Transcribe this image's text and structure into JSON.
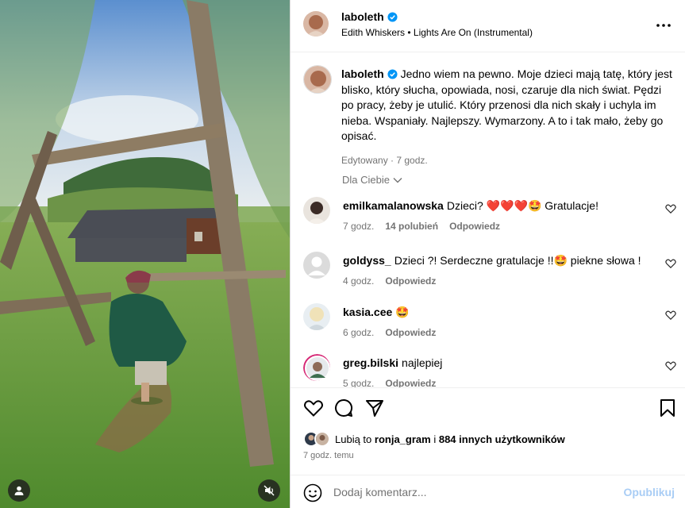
{
  "post": {
    "author": "laboleth",
    "song": "Edith Whiskers • Lights Are On (Instrumental)",
    "caption": "Jedno wiem na pewno. Moje dzieci mają tatę, który jest blisko, który słucha, opowiada, nosi, czaruje dla nich świat. Pędzi po pracy, żeby je utulić. Który przenosi dla nich skały i uchyla im nieba. Wspaniały. Najlepszy. Wymarzony. A to i tak mało, żeby go opisać.",
    "caption_meta": "Edytowany · 7 godz.",
    "filter_label": "Dla Ciebie"
  },
  "comments": [
    {
      "user": "emilkamalanowska",
      "text": "Dzieci? ❤️❤️❤️🤩 Gratulacje!",
      "time": "7 godz.",
      "likes": "14 polubień",
      "reply": "Odpowiedz"
    },
    {
      "user": "goldyss_",
      "text": "Dzieci ?! Serdeczne gratulacje !!🤩 piekne słowa !",
      "time": "4 godz.",
      "likes": "",
      "reply": "Odpowiedz"
    },
    {
      "user": "kasia.cee",
      "text": "🤩",
      "time": "6 godz.",
      "likes": "",
      "reply": "Odpowiedz"
    },
    {
      "user": "greg.bilski",
      "text": "najlepiej",
      "time": "5 godz.",
      "likes": "",
      "reply": "Odpowiedz"
    }
  ],
  "likes": {
    "prefix": "Lubią to",
    "user": "ronja_gram",
    "joiner": "i",
    "others": "884 innych użytkowników"
  },
  "timestamp": "7 godz. temu",
  "add_comment": {
    "placeholder": "Dodaj komentarz...",
    "publish_label": "Opublikuj"
  },
  "icons": {
    "more": "more-horizontal-icon",
    "like": "heart-icon",
    "comment": "comment-icon",
    "share": "share-icon",
    "save": "bookmark-icon",
    "emoji": "emoji-icon",
    "tag": "user-tag-icon",
    "mute": "muted-speaker-icon",
    "verified": "verified-badge-icon",
    "filter_chevron": "chevron-down-icon"
  },
  "colors": {
    "verified": "#0095f6",
    "muted_text": "#737373",
    "publish_disabled": "#a9cdf5",
    "story_ring": "#d62976"
  }
}
